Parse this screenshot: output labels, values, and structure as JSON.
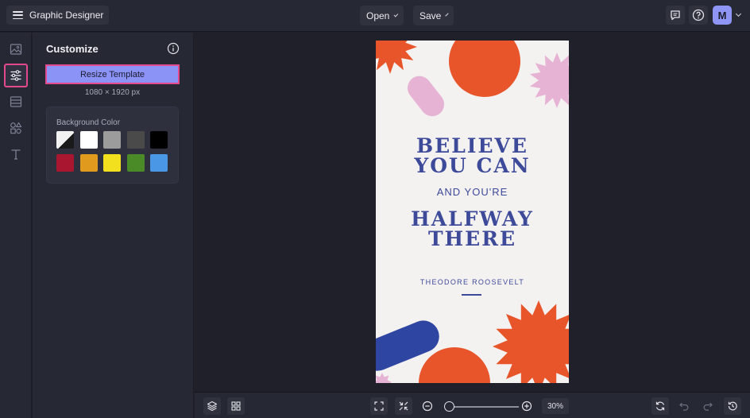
{
  "app": {
    "title": "Graphic Designer",
    "avatar_letter": "M",
    "accent": "#8c93f7",
    "highlight": "#e24a8d"
  },
  "toolbar": {
    "open_label": "Open",
    "save_label": "Save"
  },
  "rail": {
    "items": [
      {
        "name": "images-icon",
        "active": false
      },
      {
        "name": "sliders-icon",
        "active": true
      },
      {
        "name": "layout-icon",
        "active": false
      },
      {
        "name": "shapes-icon",
        "active": false
      },
      {
        "name": "text-icon",
        "active": false
      }
    ]
  },
  "panel": {
    "title": "Customize",
    "resize_label": "Resize Template",
    "dimensions": "1080 × 1920 px",
    "background_label": "Background Color",
    "swatches": [
      "#eeeeee",
      "#ffffff",
      "#9c9c9c",
      "#4a4a4a",
      "#000000",
      "#a8172f",
      "#e09a1d",
      "#f2e01f",
      "#4a8a27",
      "#4a97e6"
    ]
  },
  "canvas": {
    "line1": "BELIEVE",
    "line2": "YOU CAN",
    "line3": "AND YOU'RE",
    "line4": "HALFWAY",
    "line5": "THERE",
    "author": "THEODORE ROOSEVELT",
    "colors": {
      "background": "#f4f1f1",
      "text": "#3d4a9a",
      "orange": "#e8552a",
      "pink": "#e6b3d4",
      "blue": "#2e45a2"
    }
  },
  "bottombar": {
    "zoom": "30%",
    "zoom_level": 0.03
  }
}
